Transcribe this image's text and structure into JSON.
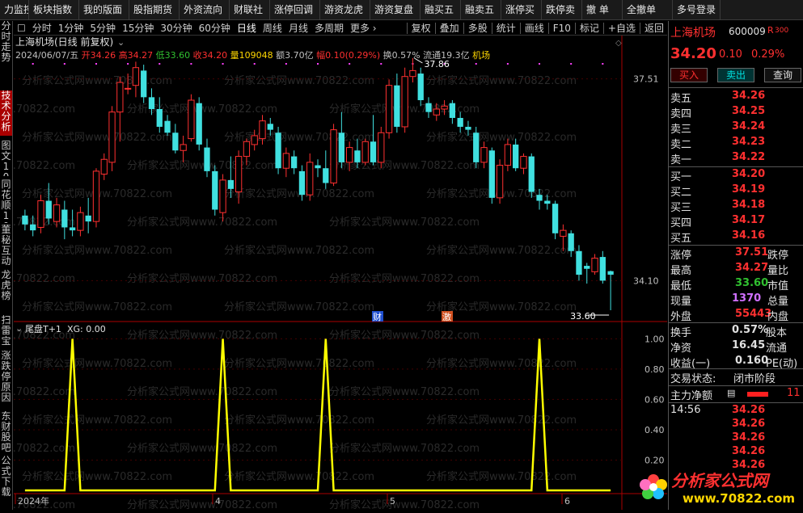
{
  "topbar": [
    "力监控",
    "板块指数",
    "我的版面",
    "股指期货",
    "外资流向",
    "财联社",
    "涨停回调",
    "游资龙虎",
    "游资复盘",
    "融买五",
    "融卖五",
    "涨停买",
    "跌停卖",
    "撤 单",
    "全撤单",
    "多号登录"
  ],
  "sidebar": [
    {
      "label": "分时走势",
      "active": false
    },
    {
      "label": "技术分析",
      "active": true
    },
    {
      "label": "图文10",
      "active": false
    },
    {
      "label": "同花顺10",
      "active": false
    },
    {
      "label": "董秘互动",
      "active": false
    },
    {
      "label": "龙虎榜",
      "active": false
    },
    {
      "label": "扫雷宝",
      "active": false
    },
    {
      "label": "涨跌停原因",
      "active": false
    },
    {
      "label": "东财股吧",
      "active": false
    },
    {
      "label": "公式下载",
      "active": false
    }
  ],
  "periods": [
    "分时",
    "1分钟",
    "5分钟",
    "15分钟",
    "30分钟",
    "60分钟",
    "日线",
    "周线",
    "月线",
    "多周期",
    "更多 ›"
  ],
  "selected_period": "日线",
  "tools": [
    "复权",
    "叠加",
    "多股",
    "统计",
    "画线",
    "F10",
    "标记",
    "+自选",
    "返回"
  ],
  "stock": {
    "title": "上海机场(日线 前复权)",
    "info_date": "2024/06/07/五",
    "open_label": "开",
    "open": "34.26",
    "high_label": "高",
    "high": "34.27",
    "low_label": "低",
    "low": "33.60",
    "close_label": "收",
    "close": "34.20",
    "vol_label": "量",
    "vol": "109048",
    "amt_label": "额",
    "amt": "3.70亿",
    "chg_label": "幅",
    "chg": "0.10(0.29%)",
    "turn": "换0.57%",
    "float": "流通19.3亿",
    "industry": "机场"
  },
  "chart_labels": {
    "max_label": "37.86",
    "min_label": "33.60",
    "y_top": "37.51",
    "y_bottom": "34.10",
    "marker_cai": "财",
    "marker_ji": "激",
    "ind_title": "尾盘T+1",
    "ind_value": "XG: 0.00",
    "ind_y": [
      "1.00",
      "0.80",
      "0.60",
      "0.40",
      "0.20"
    ],
    "x_labels": [
      "2024年",
      "4",
      "5",
      "6"
    ],
    "watermark": "分析家公式网www.70822.com"
  },
  "colors": {
    "up": "#ff3030",
    "down": "#40e0e0",
    "indicator": "#ffff00",
    "marker": "#ff40ff"
  },
  "chart_data": {
    "type": "candlestick",
    "price_ylim": [
      33.6,
      37.86
    ],
    "candles": [
      {
        "o": 35.2,
        "h": 35.3,
        "l": 34.95,
        "c": 35.05
      },
      {
        "o": 35.05,
        "h": 35.2,
        "l": 34.85,
        "c": 34.95
      },
      {
        "o": 35.0,
        "h": 35.55,
        "l": 34.9,
        "c": 35.45
      },
      {
        "o": 35.45,
        "h": 35.75,
        "l": 35.05,
        "c": 35.15
      },
      {
        "o": 35.1,
        "h": 35.5,
        "l": 35.0,
        "c": 35.38
      },
      {
        "o": 35.3,
        "h": 35.45,
        "l": 34.8,
        "c": 35.0
      },
      {
        "o": 35.0,
        "h": 35.3,
        "l": 34.85,
        "c": 34.95
      },
      {
        "o": 34.95,
        "h": 35.35,
        "l": 34.85,
        "c": 35.25
      },
      {
        "o": 35.2,
        "h": 35.5,
        "l": 34.9,
        "c": 35.1
      },
      {
        "o": 35.1,
        "h": 36.0,
        "l": 35.0,
        "c": 35.95
      },
      {
        "o": 35.9,
        "h": 36.25,
        "l": 35.8,
        "c": 36.15
      },
      {
        "o": 36.1,
        "h": 37.05,
        "l": 35.95,
        "c": 36.95
      },
      {
        "o": 36.95,
        "h": 37.55,
        "l": 36.45,
        "c": 37.45
      },
      {
        "o": 37.35,
        "h": 37.6,
        "l": 37.25,
        "c": 37.35
      },
      {
        "o": 37.4,
        "h": 37.8,
        "l": 37.2,
        "c": 37.7
      },
      {
        "o": 37.65,
        "h": 37.75,
        "l": 37.1,
        "c": 37.2
      },
      {
        "o": 37.2,
        "h": 37.35,
        "l": 36.9,
        "c": 37.0
      },
      {
        "o": 37.0,
        "h": 37.2,
        "l": 36.6,
        "c": 36.7
      },
      {
        "o": 36.8,
        "h": 36.9,
        "l": 36.55,
        "c": 36.6
      },
      {
        "o": 36.6,
        "h": 36.75,
        "l": 36.25,
        "c": 36.3
      },
      {
        "o": 36.3,
        "h": 36.55,
        "l": 36.1,
        "c": 36.4
      },
      {
        "o": 36.5,
        "h": 37.25,
        "l": 36.45,
        "c": 37.15
      },
      {
        "o": 37.1,
        "h": 37.2,
        "l": 36.3,
        "c": 36.4
      },
      {
        "o": 36.35,
        "h": 36.5,
        "l": 35.85,
        "c": 35.95
      },
      {
        "o": 35.95,
        "h": 36.05,
        "l": 35.2,
        "c": 35.3
      },
      {
        "o": 35.25,
        "h": 35.9,
        "l": 35.1,
        "c": 35.8
      },
      {
        "o": 35.8,
        "h": 36.2,
        "l": 35.5,
        "c": 35.65
      },
      {
        "o": 35.6,
        "h": 36.3,
        "l": 35.4,
        "c": 36.2
      },
      {
        "o": 36.2,
        "h": 36.5,
        "l": 36.05,
        "c": 36.45
      },
      {
        "o": 36.4,
        "h": 36.65,
        "l": 36.3,
        "c": 36.55
      },
      {
        "o": 36.5,
        "h": 36.9,
        "l": 36.4,
        "c": 36.8
      },
      {
        "o": 36.75,
        "h": 36.85,
        "l": 36.55,
        "c": 36.65
      },
      {
        "o": 36.6,
        "h": 36.7,
        "l": 35.9,
        "c": 36.0
      },
      {
        "o": 36.0,
        "h": 36.35,
        "l": 35.85,
        "c": 36.25
      },
      {
        "o": 36.2,
        "h": 36.3,
        "l": 35.9,
        "c": 36.0
      },
      {
        "o": 35.95,
        "h": 36.05,
        "l": 35.45,
        "c": 35.55
      },
      {
        "o": 35.55,
        "h": 36.25,
        "l": 35.45,
        "c": 36.1
      },
      {
        "o": 36.05,
        "h": 36.15,
        "l": 35.85,
        "c": 36.0
      },
      {
        "o": 36.0,
        "h": 36.3,
        "l": 35.65,
        "c": 35.75
      },
      {
        "o": 35.75,
        "h": 36.75,
        "l": 35.7,
        "c": 36.65
      },
      {
        "o": 36.6,
        "h": 36.95,
        "l": 36.0,
        "c": 36.1
      },
      {
        "o": 36.1,
        "h": 36.45,
        "l": 35.95,
        "c": 36.35
      },
      {
        "o": 36.3,
        "h": 36.5,
        "l": 36.0,
        "c": 36.1
      },
      {
        "o": 36.1,
        "h": 36.5,
        "l": 36.05,
        "c": 36.45
      },
      {
        "o": 36.45,
        "h": 36.9,
        "l": 36.05,
        "c": 36.1
      },
      {
        "o": 36.1,
        "h": 36.7,
        "l": 36.0,
        "c": 36.6
      },
      {
        "o": 36.6,
        "h": 37.5,
        "l": 36.5,
        "c": 37.4
      },
      {
        "o": 37.4,
        "h": 37.6,
        "l": 36.6,
        "c": 36.7
      },
      {
        "o": 36.7,
        "h": 37.7,
        "l": 36.6,
        "c": 37.55
      },
      {
        "o": 37.55,
        "h": 37.86,
        "l": 37.45,
        "c": 37.65
      },
      {
        "o": 37.6,
        "h": 37.7,
        "l": 37.05,
        "c": 37.15
      },
      {
        "o": 37.1,
        "h": 37.2,
        "l": 36.85,
        "c": 36.95
      },
      {
        "o": 36.9,
        "h": 37.1,
        "l": 36.8,
        "c": 37.0
      },
      {
        "o": 37.0,
        "h": 37.15,
        "l": 36.9,
        "c": 37.05
      },
      {
        "o": 37.1,
        "h": 37.15,
        "l": 36.75,
        "c": 36.85
      },
      {
        "o": 36.85,
        "h": 36.95,
        "l": 36.6,
        "c": 36.7
      },
      {
        "o": 36.7,
        "h": 36.8,
        "l": 36.55,
        "c": 36.65
      },
      {
        "o": 36.6,
        "h": 36.7,
        "l": 36.0,
        "c": 36.1
      },
      {
        "o": 36.1,
        "h": 36.45,
        "l": 36.0,
        "c": 36.35
      },
      {
        "o": 36.3,
        "h": 36.35,
        "l": 35.4,
        "c": 35.5
      },
      {
        "o": 35.5,
        "h": 36.15,
        "l": 35.4,
        "c": 36.05
      },
      {
        "o": 36.05,
        "h": 36.5,
        "l": 35.95,
        "c": 36.4
      },
      {
        "o": 36.4,
        "h": 36.5,
        "l": 35.95,
        "c": 36.0
      },
      {
        "o": 36.0,
        "h": 36.25,
        "l": 35.9,
        "c": 36.2
      },
      {
        "o": 36.2,
        "h": 36.25,
        "l": 35.5,
        "c": 35.6
      },
      {
        "o": 35.55,
        "h": 35.65,
        "l": 35.3,
        "c": 35.45
      },
      {
        "o": 35.45,
        "h": 35.55,
        "l": 35.3,
        "c": 35.4
      },
      {
        "o": 35.4,
        "h": 35.45,
        "l": 34.8,
        "c": 34.9
      },
      {
        "o": 34.85,
        "h": 35.05,
        "l": 34.6,
        "c": 34.95
      },
      {
        "o": 34.9,
        "h": 34.95,
        "l": 34.5,
        "c": 34.6
      },
      {
        "o": 34.6,
        "h": 34.7,
        "l": 34.1,
        "c": 34.2
      },
      {
        "o": 34.35,
        "h": 34.4,
        "l": 34.05,
        "c": 34.3
      },
      {
        "o": 34.25,
        "h": 34.55,
        "l": 34.2,
        "c": 34.48
      },
      {
        "o": 34.5,
        "h": 34.6,
        "l": 34.05,
        "c": 34.1
      },
      {
        "o": 34.26,
        "h": 34.27,
        "l": 33.6,
        "c": 34.2
      }
    ],
    "signal_days": [
      6,
      25,
      38,
      65,
      77
    ],
    "indicator_name": "尾盘T+1",
    "indicator_ylim": [
      0,
      1.05
    ]
  },
  "quote": {
    "name": "上海机场",
    "code": "600009",
    "r": "R",
    "r_value": "300",
    "price": "34.20",
    "change": "0.10",
    "pct": "0.29%",
    "buy_btn": "买入",
    "sell_btn": "卖出",
    "query_btn": "查询",
    "asks": [
      {
        "label": "卖五",
        "price": "34.26"
      },
      {
        "label": "卖四",
        "price": "34.25"
      },
      {
        "label": "卖三",
        "price": "34.24"
      },
      {
        "label": "卖二",
        "price": "34.23"
      },
      {
        "label": "卖一",
        "price": "34.22"
      }
    ],
    "bids": [
      {
        "label": "买一",
        "price": "34.20"
      },
      {
        "label": "买二",
        "price": "34.19"
      },
      {
        "label": "买三",
        "price": "34.18"
      },
      {
        "label": "买四",
        "price": "34.17"
      },
      {
        "label": "买五",
        "price": "34.16"
      }
    ],
    "stats": [
      {
        "l1": "涨停",
        "v1": "37.51",
        "c1": "red",
        "l2": "跌停"
      },
      {
        "l1": "最高",
        "v1": "34.27",
        "c1": "red",
        "l2": "量比"
      },
      {
        "l1": "最低",
        "v1": "33.60",
        "c1": "grn",
        "l2": "市值"
      },
      {
        "l1": "现量",
        "v1": "1370",
        "c1": "mag",
        "l2": "总量"
      },
      {
        "l1": "外盘",
        "v1": "55443",
        "c1": "red",
        "l2": "内盘"
      }
    ],
    "stats2": [
      {
        "l1": "换手",
        "v1": "0.57%",
        "l2": "股本"
      },
      {
        "l1": "净资",
        "v1": "16.45",
        "l2": "流通"
      },
      {
        "l1": "收益(一)",
        "v1": "0.160",
        "l2": "PE(动)"
      }
    ],
    "trade_status_label": "交易状态:",
    "trade_status": "闭市阶段",
    "main_net": "主力净额",
    "main_net_val": "11",
    "ticks": [
      {
        "time": "14:56",
        "price": "34.26"
      },
      {
        "time": "",
        "price": "34.26"
      },
      {
        "time": "",
        "price": "34.26"
      },
      {
        "time": "",
        "price": "34.26"
      },
      {
        "time": "",
        "price": "34.26"
      }
    ]
  },
  "logo": {
    "text": "分析家公式网",
    "url": "www.70822.com"
  }
}
